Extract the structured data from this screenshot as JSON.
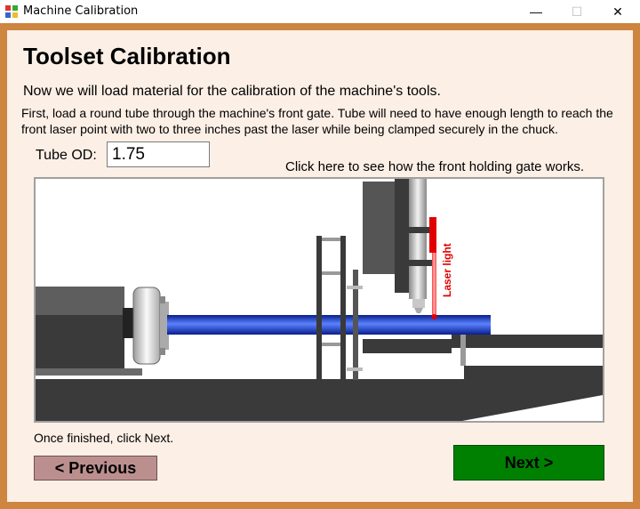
{
  "window": {
    "title": "Machine Calibration",
    "controls": {
      "minimize": "—",
      "maximize": "☐",
      "close": "✕"
    },
    "icon": "app-icon"
  },
  "page": {
    "heading": "Toolset Calibration",
    "lead": "Now we will load material for the calibration of the machine's tools.",
    "instructions": "First, load a round tube through the machine's front gate. Tube will need to have enough length to reach the front laser point with two to three inches past the laser while being clamped securely in the chuck.",
    "tube_od_label": "Tube OD:",
    "tube_od_value": "1.75",
    "gate_link": "Click here to see how the front holding gate works.",
    "diagram_label": "Laser light",
    "finish_note": "Once finished, click Next."
  },
  "buttons": {
    "previous": "< Previous",
    "next": "Next >"
  },
  "colors": {
    "frame": "#cd853f",
    "client_bg": "#fcefe6",
    "previous_bg": "#bc8f8f",
    "next_bg": "#008000",
    "tube": "#3355dd",
    "laser": "#e00000"
  }
}
